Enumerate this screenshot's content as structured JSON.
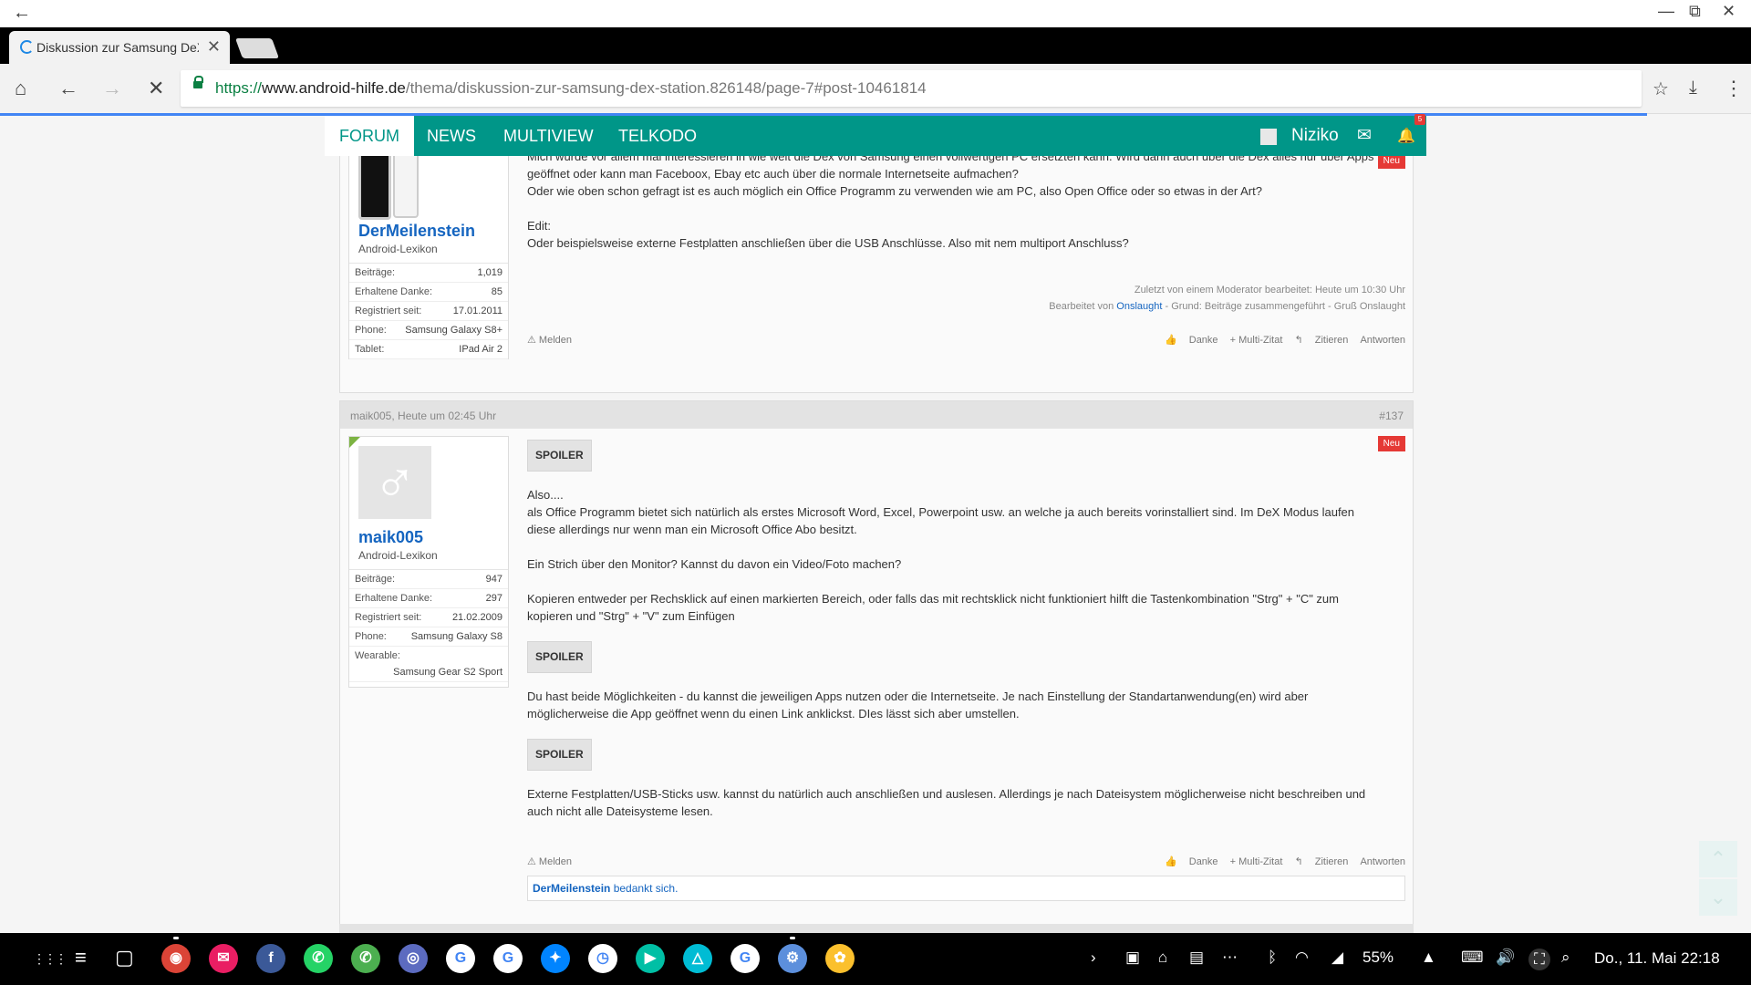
{
  "window": {
    "back_glyph": "←",
    "minimize_glyph": "—",
    "restore_glyph": "⧉",
    "close_glyph": "✕"
  },
  "tab": {
    "title": "Diskussion zur Samsung DeX",
    "close_glyph": "✕"
  },
  "toolbar": {
    "home_glyph": "⌂",
    "back_glyph": "←",
    "forward_glyph": "→",
    "stop_glyph": "✕",
    "url_scheme": "https://",
    "url_domain": "www.android-hilfe.de",
    "url_path": "/thema/diskussion-zur-samsung-dex-station.826148/page-7#post-10461814",
    "star_glyph": "☆",
    "download_glyph": "⤓",
    "menu_glyph": "⋮"
  },
  "nav": {
    "items": [
      "FORUM",
      "NEWS",
      "MULTIVIEW",
      "TELKODO"
    ],
    "username": "Niziko",
    "mail_glyph": "✉",
    "bell_glyph": "🔔",
    "bell_count": "5"
  },
  "post1": {
    "neu": "Neu",
    "lines": [
      "Mich würde vor allem mal interessieren in wie weit die Dex von Samsung einen vollwertigen PC ersetzten kann. Wird dann auch über die Dex alles nur über Apps",
      "geöffnet oder kann man Faceboox, Ebay etc auch über die normale Internetseite aufmachen?",
      "Oder wie oben schon gefragt ist es auch möglich ein Office Programm zu verwenden wie am PC, also Open Office oder so etwas in der Art?",
      "",
      "Edit:",
      "Oder beispielsweise externe Festplatten anschließen über die USB Anschlüsse. Also mit nem multiport Anschluss?"
    ],
    "meta1": "Zuletzt von einem Moderator bearbeitet: Heute um 10:30 Uhr",
    "meta2_prefix": "Bearbeitet von ",
    "meta2_link": "Onslaught",
    "meta2_suffix": " - Grund: Beiträge zusammengeführt - Gruß Onslaught",
    "user": {
      "name": "DerMeilenstein",
      "rank": "Android-Lexikon",
      "stats": [
        {
          "k": "Beiträge:",
          "v": "1,019"
        },
        {
          "k": "Erhaltene Danke:",
          "v": "85"
        },
        {
          "k": "Registriert seit:",
          "v": "17.01.2011"
        },
        {
          "k": "Phone:",
          "v": "Samsung Galaxy S8+"
        },
        {
          "k": "Tablet:",
          "v": "IPad Air 2"
        }
      ]
    }
  },
  "actions": {
    "report": "Melden",
    "thanks": "Danke",
    "multiquote": "+ Multi-Zitat",
    "quote": "Zitieren",
    "reply": "Antworten"
  },
  "post2": {
    "header_who": "maik005, Heute um 02:45 Uhr",
    "header_num": "#137",
    "neu": "Neu",
    "spoiler_label": "SPOILER",
    "para1": [
      "Also....",
      "als Office Programm bietet sich natürlich als erstes Microsoft Word, Excel, Powerpoint usw. an welche ja auch bereits vorinstalliert sind. Im DeX Modus laufen",
      "diese allerdings nur wenn man ein Microsoft Office Abo besitzt.",
      "",
      "Ein Strich über den Monitor? Kannst du davon ein Video/Foto machen?",
      "",
      "Kopieren entweder per Rechsklick auf einen markierten Bereich, oder falls das mit rechtsklick nicht funktioniert hilft die Tastenkombination \"Strg\" + \"C\" zum",
      "kopieren und \"Strg\" + \"V\" zum Einfügen"
    ],
    "para2": [
      "Du hast beide Möglichkeiten - du kannst die jeweiligen Apps nutzen oder die Internetseite. Je nach Einstellung der Standartanwendung(en) wird aber",
      "möglicherweise die App geöffnet wenn du einen Link anklickst. DIes lässt sich aber umstellen."
    ],
    "para3": [
      "Externe Festplatten/USB-Sticks usw. kannst du natürlich auch anschließen und auslesen. Allerdings je nach Dateisystem möglicherweise nicht beschreiben und",
      "auch nicht alle Dateisysteme lesen."
    ],
    "likes_user": "DerMeilenstein",
    "likes_text": " bedankt sich.",
    "user": {
      "name": "maik005",
      "rank": "Android-Lexikon",
      "avatar_glyph": "♂",
      "stats": [
        {
          "k": "Beiträge:",
          "v": "947"
        },
        {
          "k": "Erhaltene Danke:",
          "v": "297"
        },
        {
          "k": "Registriert seit:",
          "v": "21.02.2009"
        },
        {
          "k": "Phone:",
          "v": "Samsung Galaxy S8"
        },
        {
          "k": "Wearable:",
          "v": ""
        }
      ],
      "wearable_value": "Samsung Gear S2 Sport"
    }
  },
  "scroll": {
    "up_glyph": "⌃",
    "down_glyph": "⌄"
  },
  "taskbar": {
    "apps_glyph": "⋮⋮⋮",
    "recent_glyph": "≡",
    "back_glyph": "▢",
    "apps": [
      {
        "name": "chrome",
        "glyph": "◉",
        "color": "#db4437"
      },
      {
        "name": "email",
        "glyph": "✉",
        "color": "#e91e63"
      },
      {
        "name": "facebook",
        "glyph": "f",
        "color": "#3b5998"
      },
      {
        "name": "whatsapp",
        "glyph": "✆",
        "color": "#25d366"
      },
      {
        "name": "phone",
        "glyph": "✆",
        "color": "#4caf50"
      },
      {
        "name": "camera",
        "glyph": "◎",
        "color": "#5c6bc0"
      },
      {
        "name": "google",
        "glyph": "G",
        "color": "#ffffff"
      },
      {
        "name": "google2",
        "glyph": "G",
        "color": "#ffffff"
      },
      {
        "name": "messenger",
        "glyph": "✦",
        "color": "#0084ff"
      },
      {
        "name": "clock",
        "glyph": "◷",
        "color": "#ffffff"
      },
      {
        "name": "play-movies",
        "glyph": "▶",
        "color": "#00bfa5"
      },
      {
        "name": "bixby",
        "glyph": "△",
        "color": "#00bcd4"
      },
      {
        "name": "google3",
        "glyph": "G",
        "color": "#ffffff"
      },
      {
        "name": "settings",
        "glyph": "⚙",
        "color": "#5c8fdc"
      },
      {
        "name": "gallery",
        "glyph": "✿",
        "color": "#fbc02d"
      }
    ],
    "battery": "55%",
    "clock": "Do., 11. Mai  22:18"
  }
}
